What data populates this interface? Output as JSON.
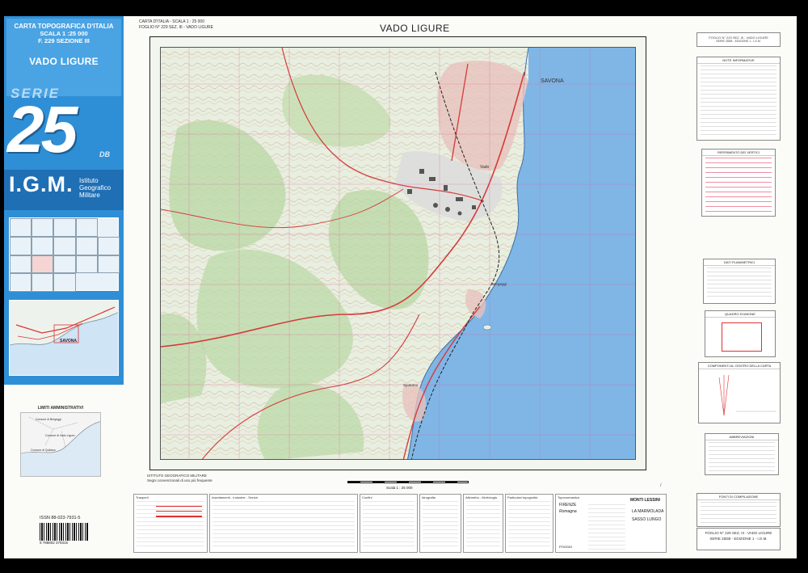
{
  "cover": {
    "line1": "CARTA TOPOGRAFICA D'ITALIA",
    "line2": "SCALA 1 :25 000",
    "line3": "F. 229 SEZIONE III",
    "place": "VADO LIGURE",
    "serie": "SERIE",
    "series_number": "25",
    "series_suffix": "DB",
    "igm": "I.G.M.",
    "igm_sub": [
      "Istituto",
      "Geografico",
      "Militare"
    ],
    "locator_label": "SAVONA"
  },
  "admin": {
    "title": "LIMITI AMMINISTRATIVI",
    "regions": [
      "Comune di Bergeggi",
      "Comune di Vado Ligure",
      "Comune di Quiliano"
    ]
  },
  "isbn": "ISSN 88-023-7931-5",
  "barcode_number": "9 788802 379315",
  "map": {
    "header_lines": [
      "CARTA D'ITALIA - SCALA 1 : 25 000",
      "FOGLIO N° 229 SEZ. III - VADO LIGURE"
    ],
    "title": "VADO LIGURE",
    "places": [
      "SAVONA",
      "Vado",
      "Bergeggi",
      "Spotorno"
    ],
    "note_lines": [
      "ISTITUTO GEOGRAFICO MILITARE",
      "Segni convenzionali di uso più frequente"
    ],
    "scale_text": "Scala 1 : 25 000"
  },
  "right_panel": {
    "header_lines": [
      "FOGLIO N° 229 SEZ. III - VADO LIGURE",
      "SERIE 25DB - EDIZIONE 1 - I.G.M."
    ],
    "boxes": [
      "NOTE INFORMATIVE",
      "RIFERIMENTO DEI VERTICI",
      "DATI PLANIMETRICI",
      "QUADRO D'UNIONE",
      "COMPONENTI AL CENTRO DELLA CARTA",
      "ABBREVIAZIONI",
      "FONTI DI COMPILAZIONE"
    ]
  },
  "legend": {
    "sections": [
      "Trasporti",
      "Insediamenti - Industrie - Servizi",
      "Confini",
      "Idrografia",
      "Altimetria - Morfologia",
      "Particolari topografici",
      "Toponomastica"
    ],
    "toponym_samples": [
      "FIRENZE",
      "Romagna",
      "MONTI LESSINI",
      "LA MARMOLADA",
      "SASSO LUNGO",
      "POGGIO"
    ]
  },
  "footer": {
    "lines": [
      "FOGLIO N° 229 SEZ. III - VADO LIGURE",
      "SERIE 25DB - EDIZIONE 1 - I.G.M."
    ]
  }
}
